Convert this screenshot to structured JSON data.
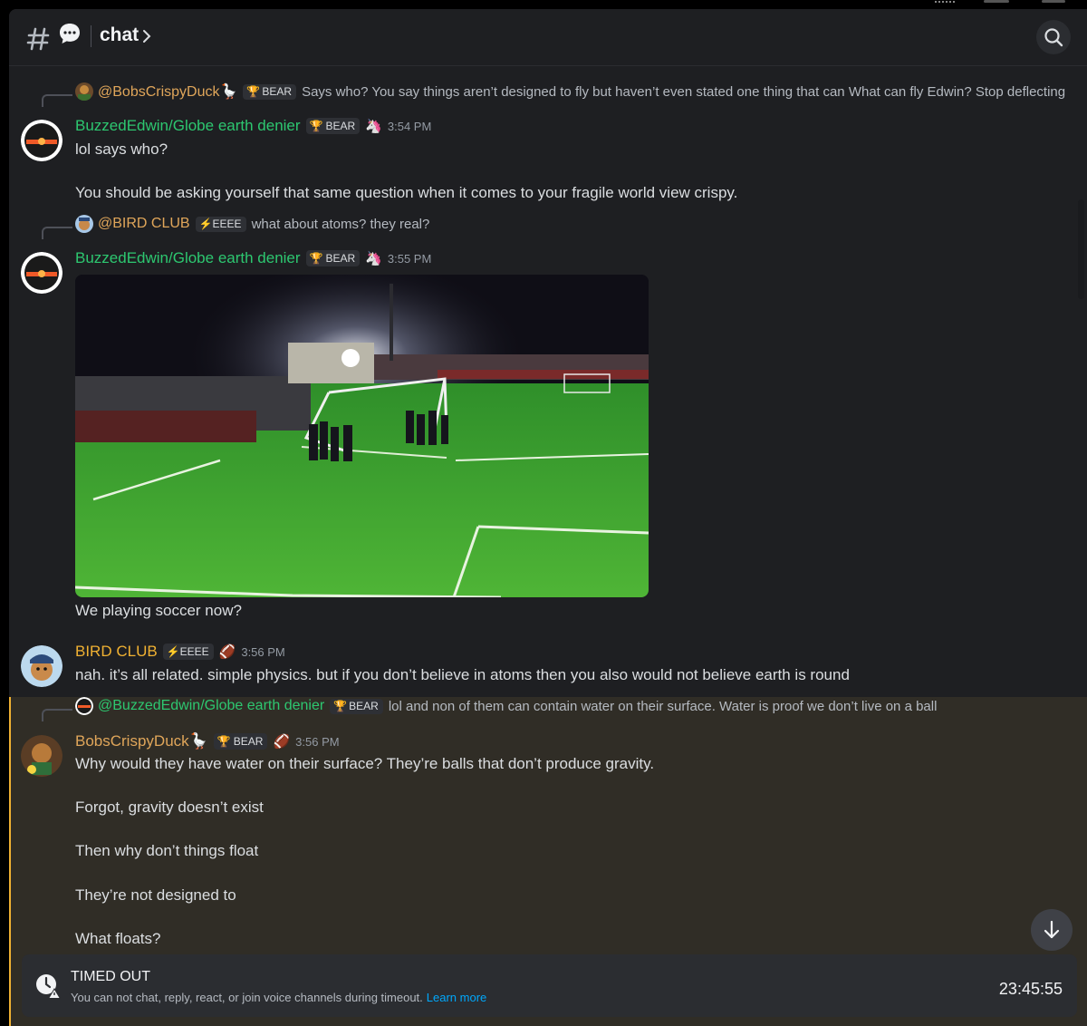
{
  "header": {
    "title": "chat",
    "icons": [
      "channel-hash-icon",
      "thread-bubble-icon",
      "chevron-right-icon",
      "search-icon"
    ]
  },
  "messages": [
    {
      "reply": {
        "user": "@BobsCrispyDuck🪿",
        "badge": "BEAR",
        "text": "Says who? You say things aren’t designed to fly but haven’t even stated one thing that can   What can fly Edwin? Stop deflecting"
      },
      "author": "BuzzedEdwin/Globe earth denier",
      "badge": "BEAR",
      "time": "3:54 PM",
      "lines": [
        "lol says who?",
        "You should be asking yourself that same question when it comes to your fragile world view crispy."
      ]
    },
    {
      "reply": {
        "user": "@BIRD CLUB",
        "badge": "⚡EEEE",
        "text": "what about atoms? they real?"
      },
      "author": "BuzzedEdwin/Globe earth denier",
      "badge": "BEAR",
      "time": "3:55 PM",
      "attachment": "soccer-field-video",
      "lines": [
        "We playing soccer now?"
      ]
    },
    {
      "author": "BIRD CLUB",
      "badge": "⚡EEEE",
      "time": "3:56 PM",
      "lines": [
        "nah. it’s all related. simple physics. but if you don’t believe in atoms then you also would not believe earth is round"
      ]
    },
    {
      "reply": {
        "user": "@BuzzedEdwin/Globe earth denier",
        "badge": "BEAR",
        "text": "lol and non of them can contain water on their surface.   Water is proof we don’t live on a ball"
      },
      "author": "BobsCrispyDuck🪿",
      "badge": "BEAR",
      "time": "3:56 PM",
      "lines": [
        "Why would they have water on their surface? They’re balls that don’t produce gravity.",
        "Forgot, gravity doesn’t exist",
        "Then why don’t things float",
        "They’re not designed to",
        "What floats?"
      ]
    }
  ],
  "timeout": {
    "title": "TIMED OUT",
    "subtitle": "You can not chat, reply, react, or join voice channels during timeout.",
    "link": "Learn more",
    "timer": "23:45:55"
  },
  "colors": {
    "background": "#1e1f22",
    "highlight": "#302d26",
    "accent": "#f0b132",
    "green_name": "#2dc770",
    "link": "#00a8fc"
  }
}
